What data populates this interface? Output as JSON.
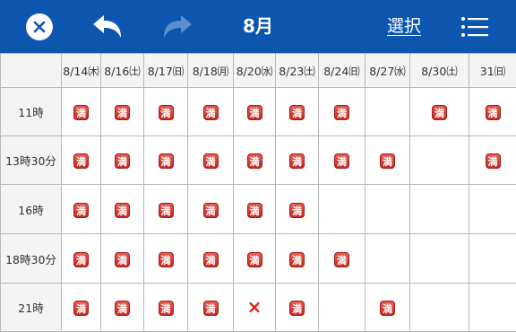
{
  "header": {
    "month": "8月",
    "select_label": "選択",
    "icons": [
      "close-icon",
      "back-arrow-icon",
      "forward-arrow-icon",
      "list-menu-icon"
    ],
    "colors": {
      "bar": "#0d56b0",
      "forward_disabled": "#5c8fd0"
    }
  },
  "calendar": {
    "dates": [
      "8/14㈭",
      "8/16㈯",
      "8/17㈰",
      "8/18㈪",
      "8/20㈬",
      "8/23㈯",
      "8/24㈰",
      "8/27㈬",
      "8/30㈯",
      "31㈰"
    ],
    "rows": [
      {
        "time": "11時",
        "cells": [
          "満",
          "満",
          "満",
          "満",
          "満",
          "満",
          "満",
          "",
          "満",
          "満"
        ]
      },
      {
        "time": "13時30分",
        "cells": [
          "満",
          "満",
          "満",
          "満",
          "満",
          "満",
          "満",
          "満",
          "",
          "満"
        ]
      },
      {
        "time": "16時",
        "cells": [
          "満",
          "満",
          "満",
          "満",
          "満",
          "満",
          "",
          "",
          "",
          ""
        ]
      },
      {
        "time": "18時30分",
        "cells": [
          "満",
          "満",
          "満",
          "満",
          "満",
          "満",
          "満",
          "",
          "",
          ""
        ]
      },
      {
        "time": "21時",
        "cells": [
          "満",
          "満",
          "満",
          "満",
          "×",
          "満",
          "",
          "満",
          "",
          ""
        ]
      }
    ]
  }
}
